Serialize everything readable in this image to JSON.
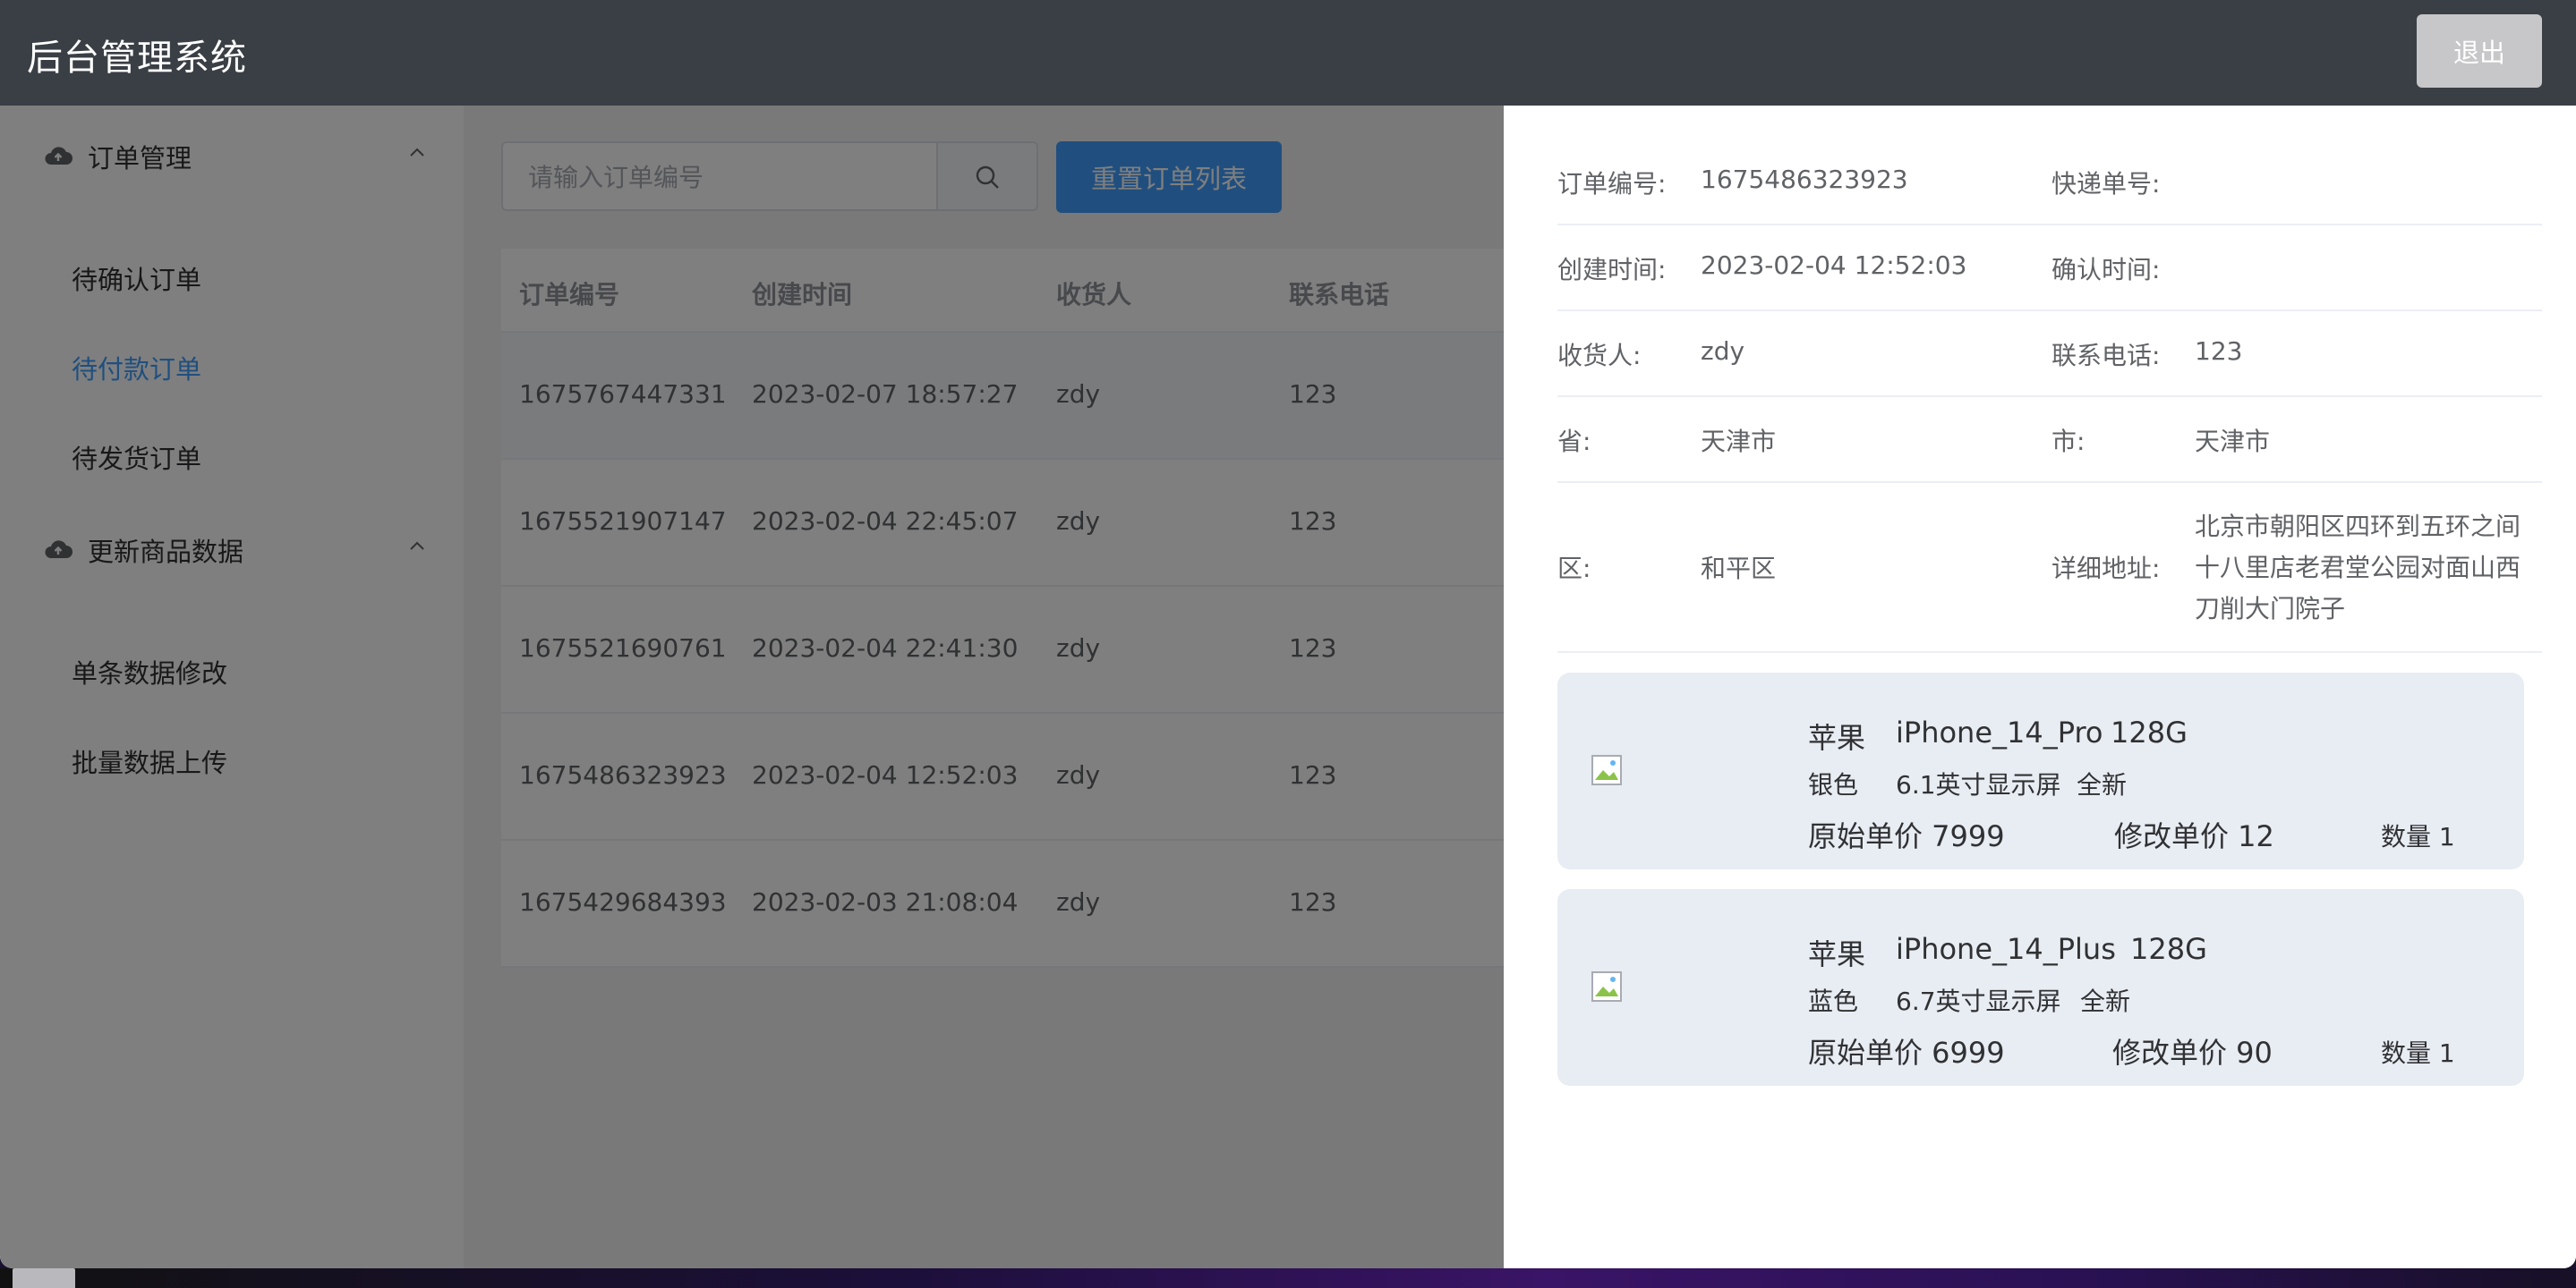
{
  "header": {
    "title": "后台管理系统",
    "logout_label": "退出"
  },
  "sidebar": {
    "groups": [
      {
        "label": "订单管理",
        "items": [
          "待确认订单",
          "待付款订单",
          "待发货订单"
        ]
      },
      {
        "label": "更新商品数据",
        "items": [
          "单条数据修改",
          "批量数据上传"
        ]
      }
    ],
    "active_item": "待付款订单"
  },
  "toolbar": {
    "search_placeholder": "请输入订单编号",
    "reset_label": "重置订单列表"
  },
  "table": {
    "columns": [
      "订单编号",
      "创建时间",
      "收货人",
      "联系电话"
    ],
    "rows": [
      [
        "1675767447331",
        "2023-02-07 18:57:27",
        "zdy",
        "123"
      ],
      [
        "1675521907147",
        "2023-02-04 22:45:07",
        "zdy",
        "123"
      ],
      [
        "1675521690761",
        "2023-02-04 22:41:30",
        "zdy",
        "123"
      ],
      [
        "1675486323923",
        "2023-02-04 12:52:03",
        "zdy",
        "123"
      ],
      [
        "1675429684393",
        "2023-02-03 21:08:04",
        "zdy",
        "123"
      ]
    ]
  },
  "drawer": {
    "details": [
      {
        "label": "订单编号:",
        "value": "1675486323923",
        "label2": "快递单号:",
        "value2": ""
      },
      {
        "label": "创建时间:",
        "value": "2023-02-04 12:52:03",
        "label2": "确认时间:",
        "value2": ""
      },
      {
        "label": "收货人:",
        "value": "zdy",
        "label2": "联系电话:",
        "value2": "123"
      },
      {
        "label": "省:",
        "value": "天津市",
        "label2": "市:",
        "value2": "天津市"
      },
      {
        "label": "区:",
        "value": "和平区",
        "label2": "详细地址:",
        "value2": "北京市朝阳区四环到五环之间十八里店老君堂公园对面山西刀削大门院子"
      }
    ],
    "products": [
      {
        "brand": "苹果",
        "model": "iPhone_14_Pro",
        "storage": "128G",
        "color": "银色",
        "screen": "6.1英寸显示屏",
        "condition": "全新",
        "orig_price_label": "原始单价 7999",
        "new_price_label": "修改单价 12",
        "qty_label": "数量 1"
      },
      {
        "brand": "苹果",
        "model": "iPhone_14_Plus",
        "storage": "128G",
        "color": "蓝色",
        "screen": "6.7英寸显示屏",
        "condition": "全新",
        "orig_price_label": "原始单价 6999",
        "new_price_label": "修改单价 90",
        "qty_label": "数量 1"
      }
    ]
  },
  "colors": {
    "header_bg": "#3a3f45",
    "accent": "#409eff",
    "logout_bg": "#c7c7c9",
    "product_bg": "#e8ecf3"
  }
}
